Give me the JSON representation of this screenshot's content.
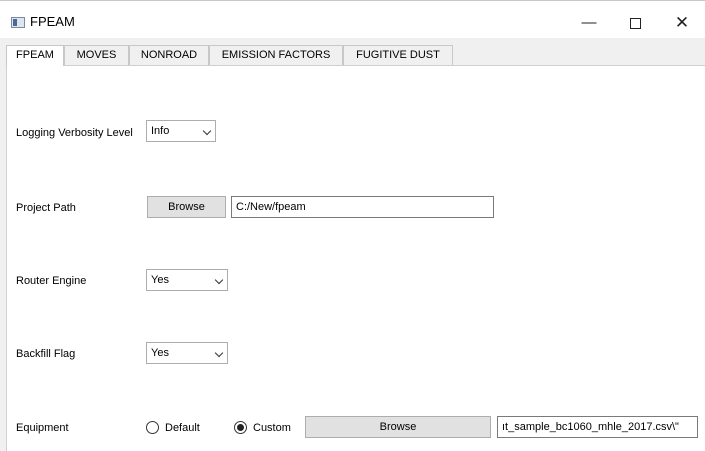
{
  "window": {
    "title": "FPEAM",
    "minimize_glyph": "—",
    "close_glyph": "✕"
  },
  "tabs": [
    {
      "label": "FPEAM",
      "active": true
    },
    {
      "label": "MOVES",
      "active": false
    },
    {
      "label": "NONROAD",
      "active": false
    },
    {
      "label": "EMISSION FACTORS",
      "active": false
    },
    {
      "label": "FUGITIVE DUST",
      "active": false
    }
  ],
  "fpeam": {
    "logging": {
      "label": "Logging Verbosity Level",
      "value": "Info"
    },
    "project_path": {
      "label": "Project Path",
      "browse_label": "Browse",
      "value": "C:/New/fpeam"
    },
    "router_engine": {
      "label": "Router Engine",
      "value": "Yes"
    },
    "backfill_flag": {
      "label": "Backfill Flag",
      "value": "Yes"
    },
    "equipment": {
      "label": "Equipment",
      "default_label": "Default",
      "custom_label": "Custom",
      "selected": "Custom",
      "browse_label": "Browse",
      "value": "ıt_sample_bc1060_mhle_2017.csv\\\""
    }
  }
}
